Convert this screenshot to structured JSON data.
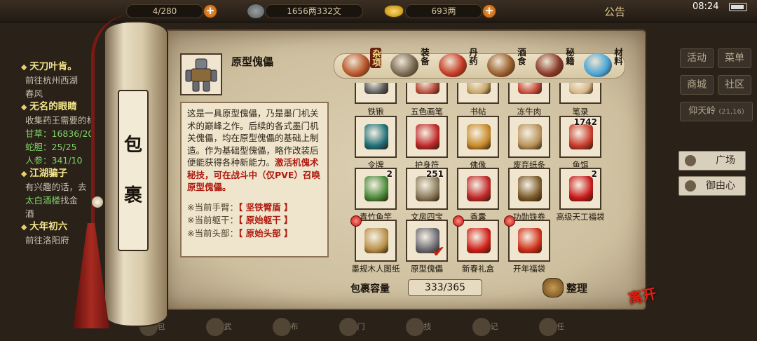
{
  "topbar": {
    "stat1": "4/280",
    "money": "1656两332文",
    "gold": "693两",
    "announcement": "公告",
    "clock": "08:24"
  },
  "quests": [
    {
      "title": "天刀叶肯。",
      "lines": [
        {
          "text": "前往杭州西湖",
          "hl": ""
        },
        {
          "text": "春风",
          "hl": ""
        }
      ]
    },
    {
      "title": "无名的眼睛",
      "lines": [
        {
          "text": "收集药王需要的材",
          "hl": ""
        },
        {
          "text": "",
          "hl": "甘草：16836/20"
        },
        {
          "text": "",
          "hl": "蛇胆：25/25"
        },
        {
          "text": "",
          "hl": "人参：341/10"
        }
      ]
    },
    {
      "title": "江湖骗子",
      "lines": [
        {
          "text": "有兴趣的话，去",
          "hl": ""
        },
        {
          "text": "找金",
          "hl": "太白酒楼"
        },
        {
          "text": "酒",
          "hl": ""
        }
      ]
    },
    {
      "title": "大年初六",
      "lines": [
        {
          "text": "前往洛阳府",
          "hl": ""
        }
      ]
    }
  ],
  "right_menu": {
    "activity": "活动",
    "menu": "菜单",
    "shop": "商城",
    "community": "社区",
    "location": "仰天岭",
    "coords": "(21,16)",
    "list_plaza": "广场",
    "list_npc": "御由心"
  },
  "bottom_nav": [
    "包",
    "武",
    "布",
    "门",
    "技",
    "记",
    "任"
  ],
  "scroll": {
    "title_1": "包",
    "title_2": "裹"
  },
  "item": {
    "name": "原型傀儡",
    "description": "这是一具原型傀儡，乃是墨门机关术的巅峰之作。后续的各式墨门机关傀儡，均在原型傀儡的基础上制造。作为基础型傀儡，略作改装后便能获得各种新能力。",
    "skill": "激活机傀术秘技，可在战斗中（仅PVE）召唤原型傀儡。",
    "parts": [
      {
        "label": "※当前手臂：",
        "value": "【 坚铁臂盾 】"
      },
      {
        "label": "※当前躯干：",
        "value": "【 原始躯干 】"
      },
      {
        "label": "※当前头部：",
        "value": "【 原始头部 】"
      }
    ]
  },
  "tabs": [
    {
      "label": "杂项",
      "active": true,
      "icon": "jar-icon",
      "color": "#b8562a"
    },
    {
      "label": "装备",
      "active": false,
      "icon": "weapon-icon",
      "color": "#7a6a54"
    },
    {
      "label": "丹药",
      "active": false,
      "icon": "pill-icon",
      "color": "#c63a26"
    },
    {
      "label": "酒食",
      "active": false,
      "icon": "food-icon",
      "color": "#9a5f2e"
    },
    {
      "label": "秘籍",
      "active": false,
      "icon": "book-icon",
      "color": "#8a3a2a"
    },
    {
      "label": "材料",
      "active": false,
      "icon": "crystal-icon",
      "color": "#4aa6d8"
    }
  ],
  "grid_rows": [
    [
      {
        "label": "铁锹",
        "count": "",
        "new": false,
        "checked": false,
        "icon": "shovel-icon",
        "color": "#5a5a5a"
      },
      {
        "label": "五色画笔",
        "count": "",
        "new": false,
        "checked": false,
        "icon": "brush-icon",
        "color": "#b84a3a"
      },
      {
        "label": "书帖",
        "count": "",
        "new": false,
        "checked": false,
        "icon": "scroll-icon",
        "color": "#c8a66a"
      },
      {
        "label": "冻牛肉",
        "count": "",
        "new": false,
        "checked": false,
        "icon": "meat-icon",
        "color": "#c44a3a"
      },
      {
        "label": "笔录",
        "count": "",
        "new": false,
        "checked": false,
        "icon": "paper-icon",
        "color": "#d8b88a"
      }
    ],
    [
      {
        "label": "令牌",
        "count": "",
        "new": false,
        "checked": false,
        "icon": "token-icon",
        "color": "#1f6f7a"
      },
      {
        "label": "护身符",
        "count": "",
        "new": false,
        "checked": false,
        "icon": "amulet-icon",
        "color": "#c0282a"
      },
      {
        "label": "佛像",
        "count": "",
        "new": false,
        "checked": false,
        "icon": "buddha-icon",
        "color": "#c88a2a"
      },
      {
        "label": "废弃纸条",
        "count": "",
        "new": false,
        "checked": false,
        "icon": "paper-scrap-icon",
        "color": "#b8925a"
      },
      {
        "label": "鱼饵",
        "count": "1742",
        "new": false,
        "checked": false,
        "icon": "worm-icon",
        "color": "#c83a2a"
      }
    ],
    [
      {
        "label": "青竹鱼竿",
        "count": "2",
        "new": false,
        "checked": false,
        "icon": "rod-icon",
        "color": "#4a8a3a"
      },
      {
        "label": "文房四宝",
        "count": "251",
        "new": false,
        "checked": false,
        "icon": "stationery-icon",
        "color": "#8a7a5a"
      },
      {
        "label": "香囊",
        "count": "",
        "new": false,
        "checked": false,
        "icon": "sachet-icon",
        "color": "#c0282a"
      },
      {
        "label": "功勋铁券",
        "count": "",
        "new": false,
        "checked": false,
        "icon": "tablet-icon",
        "color": "#7a5a2a"
      },
      {
        "label": "高级天工福袋",
        "count": "2",
        "new": false,
        "checked": false,
        "icon": "lucky-bag-icon",
        "color": "#c81a1a"
      }
    ],
    [
      {
        "label": "墨规木人图纸",
        "count": "",
        "new": true,
        "checked": false,
        "icon": "blueprint-icon",
        "color": "#b8904a"
      },
      {
        "label": "原型傀儡",
        "count": "",
        "new": false,
        "checked": true,
        "icon": "puppet-icon",
        "color": "#6a6a72"
      },
      {
        "label": "新春礼盒",
        "count": "",
        "new": true,
        "checked": false,
        "icon": "gift-box-icon",
        "color": "#d0201a"
      },
      {
        "label": "开年福袋",
        "count": "",
        "new": true,
        "checked": false,
        "icon": "fortune-bag-icon",
        "color": "#d0301a"
      }
    ]
  ],
  "footer": {
    "capacity_label": "包裹容量",
    "capacity_value": "333/365",
    "sort_label": "整理",
    "close_label": "离开"
  }
}
